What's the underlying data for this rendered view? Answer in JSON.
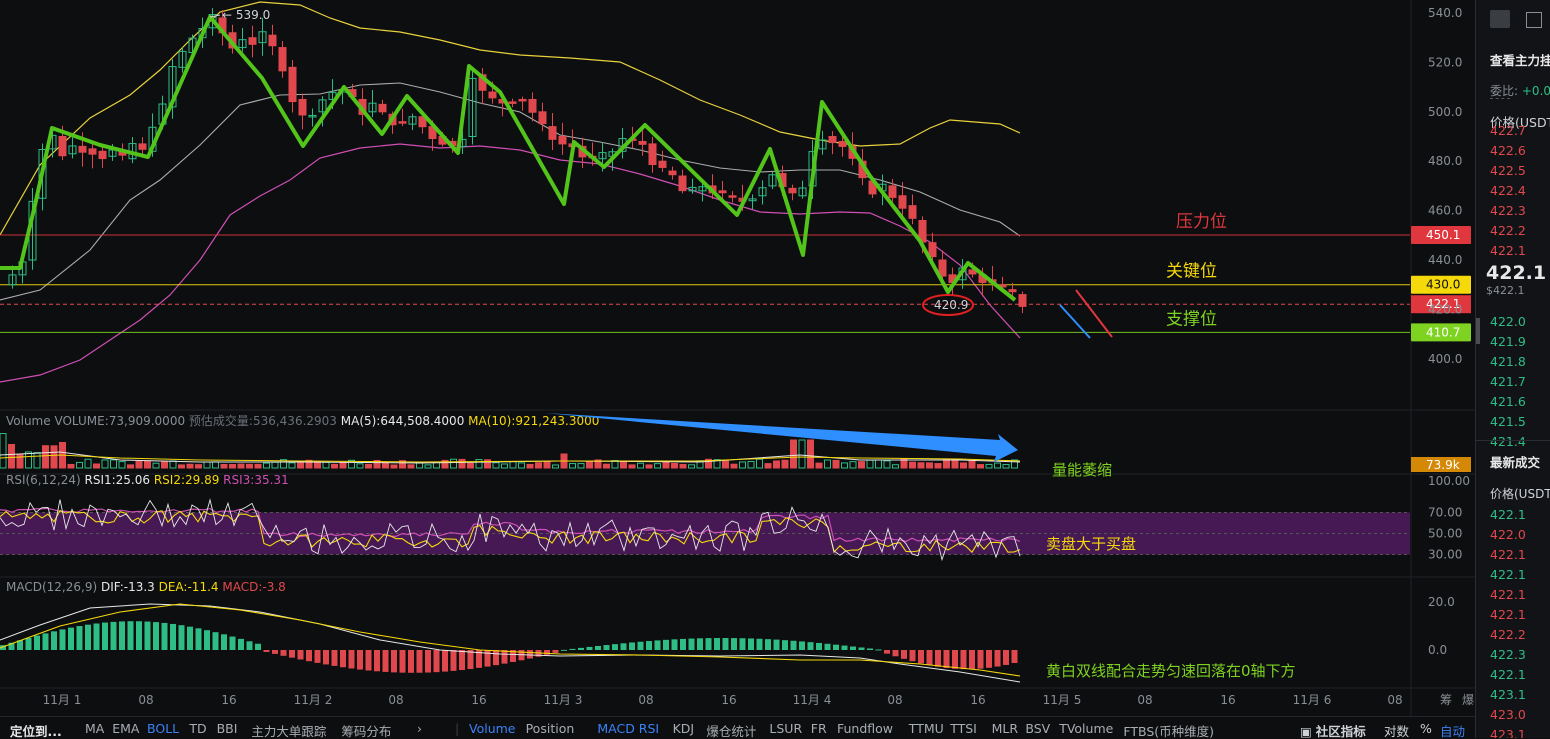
{
  "price_chart": {
    "high_marker": "539.0",
    "low_marker": "420.9",
    "y_ticks": [
      "540.0",
      "520.0",
      "500.0",
      "480.0",
      "460.0",
      "440.0",
      "420.0",
      "400.0"
    ],
    "x_labels": [
      "11月 1",
      "08",
      "16",
      "11月 2",
      "08",
      "16",
      "11月 3",
      "08",
      "16",
      "11月 4",
      "08",
      "16",
      "11月 5",
      "08",
      "16",
      "11月 6",
      "08"
    ],
    "extra_axis_labels": [
      "筹",
      "爆"
    ],
    "levels": [
      {
        "name": "压力位",
        "value": "450.1",
        "color": "#e0363d",
        "label_color": "#e0363d"
      },
      {
        "name": "关键位",
        "value": "430.0",
        "color": "#f5d90a",
        "label_color": "#f5d90a"
      },
      {
        "name": "支撑位",
        "value": "410.7",
        "color": "#7ed321",
        "label_color": "#7ed321"
      }
    ],
    "current_price_tag": "422.1",
    "colors": {
      "up": "#2ebd85",
      "down": "#e0484d",
      "zigzag": "#52c41a",
      "boll_upper": "#e8d23c",
      "boll_mid": "#c8c8c8",
      "boll_lower": "#d04fb5"
    }
  },
  "volume_panel": {
    "title": "Volume",
    "volume": "VOLUME:73,909.0000",
    "forecast": "预估成交量:536,436.2903",
    "ma5": "MA(5):644,508.4000",
    "ma10": "MA(10):921,243.3000",
    "annotation": "量能萎缩",
    "tag": "73.9k"
  },
  "rsi_panel": {
    "title": "RSI(6,12,24)",
    "rsi1": "RSI1:25.06",
    "rsi2": "RSI2:29.89",
    "rsi3": "RSI3:35.31",
    "y_ticks": [
      "100.00",
      "70.00",
      "50.00",
      "30.00"
    ],
    "annotation": "卖盘大于买盘"
  },
  "macd_panel": {
    "title": "MACD(12,26,9)",
    "dif": "DIF:-13.3",
    "dea": "DEA:-11.4",
    "macd": "MACD:-3.8",
    "y_ticks": [
      "20.0",
      "0.0"
    ],
    "annotation": "黄白双线配合走势匀速回落在0轴下方"
  },
  "toolbar": {
    "left_item": "定位到...",
    "indicators_main": [
      "MA",
      "EMA",
      "BOLL",
      "TD",
      "BBI",
      "主力大单跟踪",
      "筹码分布"
    ],
    "indicators_sub": [
      "Volume",
      "Position",
      "MACD",
      "RSI",
      "KDJ",
      "爆仓统计",
      "LSUR",
      "FR",
      "Fundflow",
      "TTMU",
      "TTSI",
      "MLR",
      "BSV",
      "TVolume",
      "FTBS(币种维度)"
    ],
    "active": [
      "BOLL",
      "Volume",
      "MACD",
      "RSI"
    ],
    "community": "社区指标",
    "log": "对数",
    "percent": "%",
    "auto": "自动"
  },
  "sidebar": {
    "orderbook_title": "查看主力挂",
    "ratio": "委比:",
    "ratio_value": "+0.0",
    "price_header": "价格(USDT",
    "asks": [
      "422.7",
      "422.6",
      "422.5",
      "422.4",
      "422.3",
      "422.2",
      "422.1"
    ],
    "last_price": "422.1",
    "last_price_usd": "$422.1",
    "bids": [
      "422.0",
      "421.9",
      "421.8",
      "421.7",
      "421.6",
      "421.5",
      "421.4"
    ],
    "trades_title": "最新成交",
    "trades_header": "价格(USDT)",
    "trades": [
      {
        "p": "422.1",
        "side": "buy"
      },
      {
        "p": "422.0",
        "side": "sell"
      },
      {
        "p": "422.1",
        "side": "sell"
      },
      {
        "p": "422.1",
        "side": "buy"
      },
      {
        "p": "422.1",
        "side": "sell"
      },
      {
        "p": "422.1",
        "side": "sell"
      },
      {
        "p": "422.2",
        "side": "sell"
      },
      {
        "p": "422.3",
        "side": "buy"
      },
      {
        "p": "422.1",
        "side": "buy"
      },
      {
        "p": "423.1",
        "side": "buy"
      },
      {
        "p": "423.0",
        "side": "sell"
      },
      {
        "p": "423.1",
        "side": "sell"
      }
    ]
  }
}
